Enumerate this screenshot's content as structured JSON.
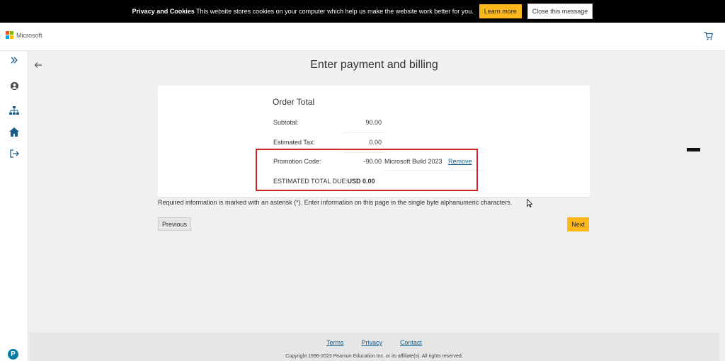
{
  "cookie_banner": {
    "title": "Privacy and Cookies",
    "message": "This website stores cookies on your computer which help us make the website work better for you.",
    "learn_more_label": "Learn more",
    "close_label": "Close this message"
  },
  "header": {
    "brand": "Microsoft",
    "cart_icon": "cart-icon"
  },
  "rail": {
    "items": [
      {
        "icon": "expand-icon"
      },
      {
        "icon": "user-icon"
      },
      {
        "icon": "sitemap-icon"
      },
      {
        "icon": "home-icon"
      },
      {
        "icon": "sign-out-icon"
      }
    ]
  },
  "page": {
    "title": "Enter payment and billing"
  },
  "order": {
    "title": "Order Total",
    "subtotal_label": "Subtotal:",
    "subtotal_value": "90.00",
    "tax_label": "Estimated Tax:",
    "tax_value": "0.00",
    "promo_label": "Promotion Code:",
    "promo_value": "-90.00",
    "promo_name": "Microsoft Build 2023",
    "remove_label": "Remove",
    "total_label": "ESTIMATED TOTAL DUE:",
    "total_value": "USD 0.00"
  },
  "required_info": "Required information is marked with an asterisk (*). Enter information on this page in the single byte alphanumeric characters.",
  "buttons": {
    "previous": "Previous",
    "next": "Next"
  },
  "footer": {
    "links": [
      "Terms",
      "Privacy",
      "Contact"
    ],
    "copyright": "Copyright 1996-2023 Pearson Education Inc. or its affiliate(s). All rights reserved."
  },
  "pearson_logo": "P",
  "colors": {
    "accent": "#ffb81c",
    "highlight": "#d0232a",
    "link": "#1a5e8a",
    "rail_icon": "#1a5e8a"
  }
}
